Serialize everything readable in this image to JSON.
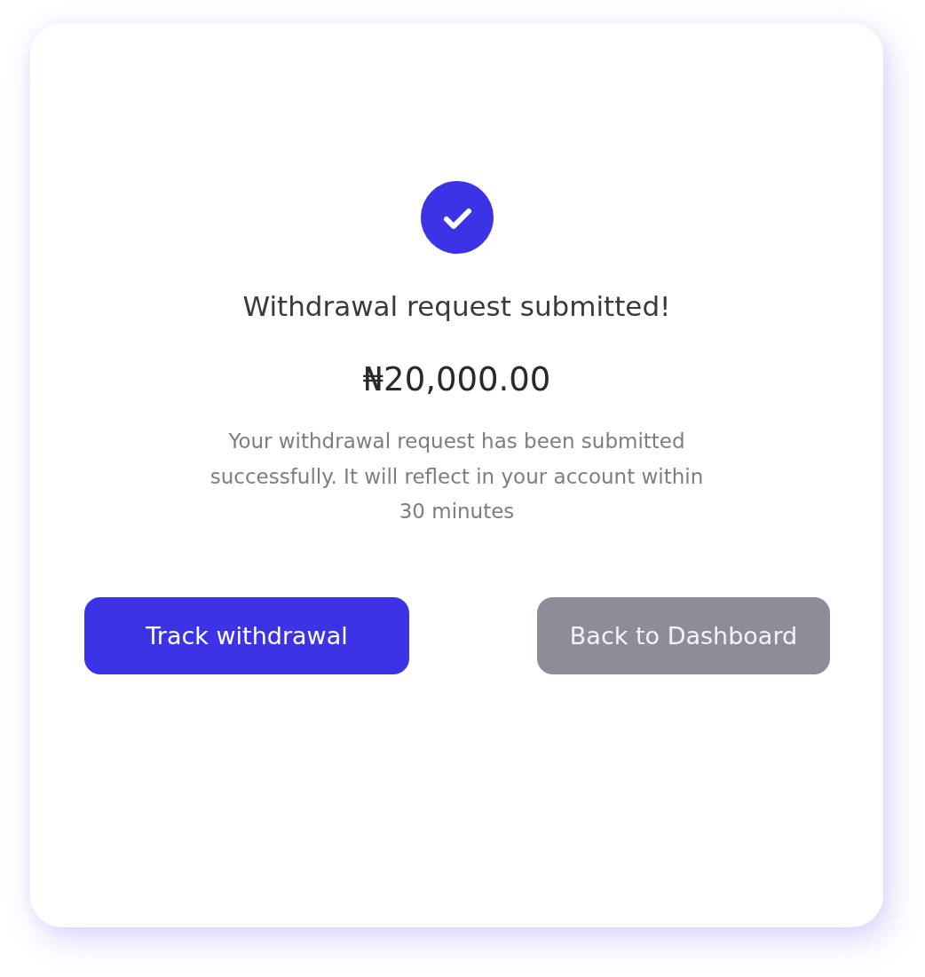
{
  "status": {
    "kind": "success"
  },
  "title": "Withdrawal request submitted!",
  "amount": "₦20,000.00",
  "message": "Your withdrawal request has been submitted successfully. It will reflect in your account within 30 minutes",
  "buttons": [
    {
      "label": "Track withdrawal",
      "kind": "primary"
    },
    {
      "label": "Back to Dashboard",
      "kind": "secondary"
    }
  ]
}
